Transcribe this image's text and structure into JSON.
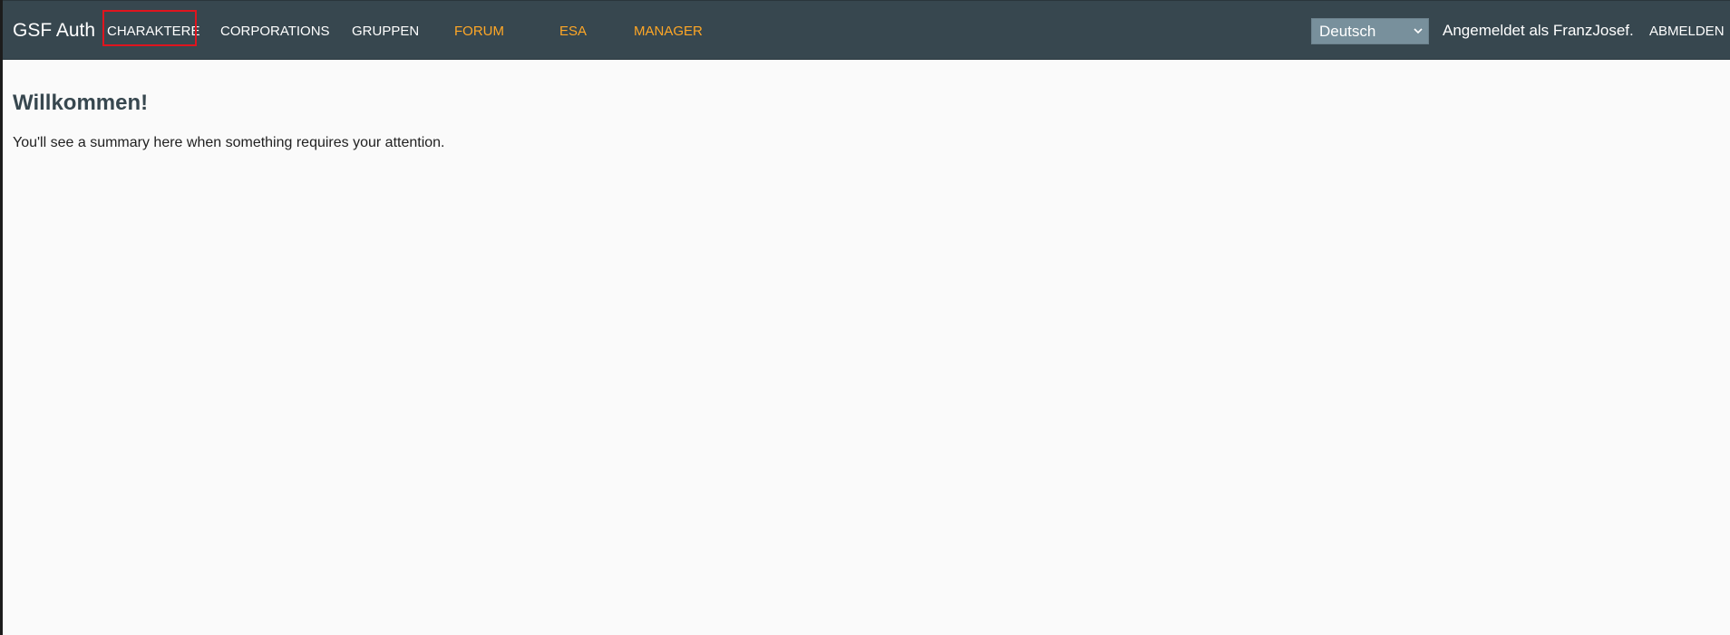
{
  "navbar": {
    "brand": "GSF Auth",
    "links": [
      {
        "label": "CHARAKTERE"
      },
      {
        "label": "CORPORATIONS"
      },
      {
        "label": "GRUPPEN"
      },
      {
        "label": "FORUM"
      },
      {
        "label": "ESA"
      },
      {
        "label": "MANAGER"
      }
    ],
    "language": {
      "selected": "Deutsch"
    },
    "logged_in_text": "Angemeldet als FranzJosef.",
    "logout_label": "ABMELDEN"
  },
  "main": {
    "heading": "Willkommen!",
    "message": "You'll see a summary here when something requires your attention."
  },
  "colors": {
    "navbar_bg": "#37474f",
    "accent_orange": "#ffa726",
    "highlight_red": "#e0141e",
    "select_bg": "#78909c",
    "heading_color": "#37474f"
  }
}
